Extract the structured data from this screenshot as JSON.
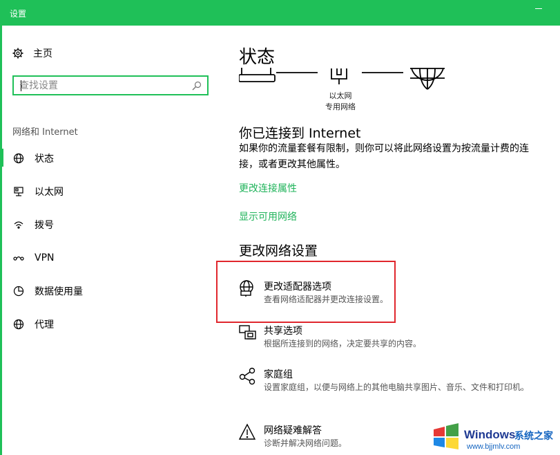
{
  "window": {
    "title": "设置"
  },
  "sidebar": {
    "home_label": "主页",
    "search_placeholder": "查找设置",
    "section_label": "网络和 Internet",
    "items": [
      {
        "label": "状态",
        "icon": "globe-status-icon",
        "active": true
      },
      {
        "label": "以太网",
        "icon": "ethernet-icon"
      },
      {
        "label": "拨号",
        "icon": "dialup-icon"
      },
      {
        "label": "VPN",
        "icon": "vpn-icon"
      },
      {
        "label": "数据使用量",
        "icon": "data-usage-icon"
      },
      {
        "label": "代理",
        "icon": "globe-icon"
      }
    ]
  },
  "main": {
    "title": "状态",
    "diagram": {
      "label_line1": "以太网",
      "label_line2": "专用网络"
    },
    "connected_heading": "你已连接到 Internet",
    "connected_desc": "如果你的流量套餐有限制，则你可以将此网络设置为按流量计费的连接，或者更改其他属性。",
    "link_change_props": "更改连接属性",
    "link_show_networks": "显示可用网络",
    "change_heading": "更改网络设置",
    "options": [
      {
        "title": "更改适配器选项",
        "desc": "查看网络适配器并更改连接设置。",
        "icon": "adapter-globe-icon"
      },
      {
        "title": "共享选项",
        "desc": "根据所连接到的网络，决定要共享的内容。",
        "icon": "sharing-icon"
      },
      {
        "title": "家庭组",
        "desc": "设置家庭组，以便与网络上的其他电脑共享图片、音乐、文件和打印机。",
        "icon": "homegroup-icon"
      },
      {
        "title": "网络疑难解答",
        "desc": "诊断并解决网络问题。",
        "icon": "warning-icon"
      }
    ]
  },
  "watermark": {
    "brand": "Windows",
    "brand_cn": "系统之家",
    "url": "www.bjjmlv.com"
  },
  "colors": {
    "accent": "#1fc058",
    "link": "#1fb35a",
    "highlight": "#e0262c"
  }
}
